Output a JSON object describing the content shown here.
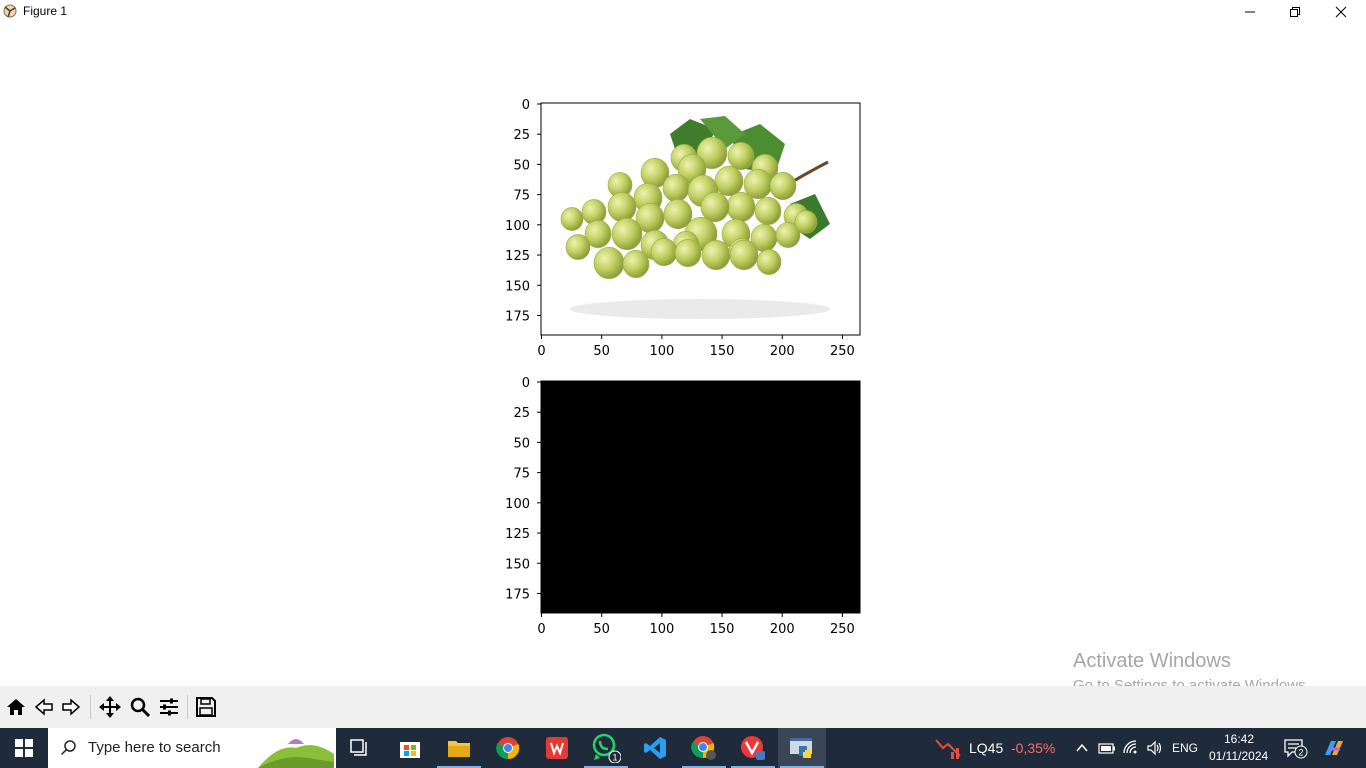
{
  "window": {
    "title": "Figure 1",
    "controls": {
      "minimize": "minimize-icon",
      "restore": "restore-icon",
      "close": "close-icon"
    }
  },
  "chart_data": [
    {
      "type": "image",
      "content": "photo of a green grape bunch with leaves on white background",
      "xticks": [
        "0",
        "50",
        "100",
        "150",
        "200",
        "250"
      ],
      "yticks": [
        "0",
        "25",
        "50",
        "75",
        "100",
        "125",
        "150",
        "175"
      ],
      "xlim": [
        0,
        265
      ],
      "ylim": [
        192,
        0
      ]
    },
    {
      "type": "image",
      "content": "solid black image",
      "fill": "#000000",
      "xticks": [
        "0",
        "50",
        "100",
        "150",
        "200",
        "250"
      ],
      "yticks": [
        "0",
        "25",
        "50",
        "75",
        "100",
        "125",
        "150",
        "175"
      ],
      "xlim": [
        0,
        265
      ],
      "ylim": [
        192,
        0
      ]
    }
  ],
  "toolbar": {
    "items": [
      "home-icon",
      "back-icon",
      "forward-icon",
      "pan-icon",
      "zoom-icon",
      "configure-subplots-icon",
      "save-icon"
    ]
  },
  "watermark": {
    "line1": "Activate Windows",
    "line2": "Go to Settings to activate Windows."
  },
  "taskbar": {
    "search_placeholder": "Type here to search",
    "apps": [
      "task-view-icon",
      "microsoft-store-icon",
      "file-explorer-icon",
      "chrome-icon",
      "wps-office-icon",
      "whatsapp-icon",
      "vscode-icon",
      "chrome-profile-icon",
      "vivaldi-icon",
      "python-icon"
    ],
    "whatsapp_badge": "1",
    "stock": {
      "name": "LQ45",
      "change": "-0,35%",
      "change_color": "#ff6b6b"
    },
    "language": "ENG",
    "time": "16:42",
    "date": "01/11/2024",
    "notification_count": "2"
  }
}
